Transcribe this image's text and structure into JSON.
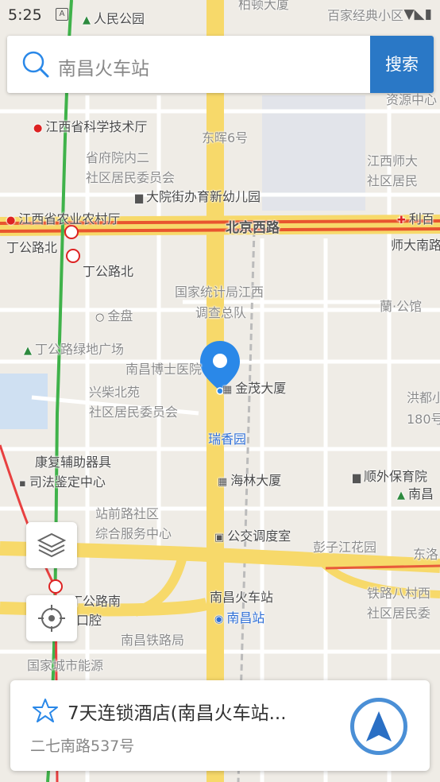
{
  "status_bar": {
    "time": "5:25",
    "sim_label": "A",
    "right_icons": "▼◣▮"
  },
  "search": {
    "query": "南昌火车站",
    "button_label": "搜索"
  },
  "map": {
    "labels": {
      "top_park": "人民公园",
      "top_building": "柏顿大厦",
      "top_right": "百家经典小区",
      "ziyuan": "资源中心",
      "kexue": "江西省科学技术厅",
      "donghui": "东晖6号",
      "shengfu_1": "省府院内二",
      "shengfu_2": "社区居民委员会",
      "jiangxi_shida_1": "江西师大",
      "jiangxi_shida_2": "社区居民",
      "dayuan": "大院街办育新幼儿园",
      "nongye": "江西省农业农村厅",
      "beijing_road": "北京西路",
      "ligong": "利百",
      "dinggong_north_1": "丁公路北",
      "dinggong_north_2": "丁公路北",
      "shida_south": "师大南路",
      "tongji_1": "国家统计局江西",
      "tongji_2": "调查总队",
      "jinpan": "金盘",
      "langong": "蘭·公馆",
      "lvdi": "丁公路绿地广场",
      "boshi": "南昌博士医院",
      "jinmao": "金茂大厦",
      "hongdu_1": "洪都小",
      "hongdu_2": "180号",
      "xingchai_1": "兴柴北苑",
      "xingchai_2": "社区居民委员会",
      "ruixiang": "瑞香园",
      "kangfu": "康复辅助器具",
      "sifa": "司法鉴定中心",
      "hailin": "海林大厦",
      "shunwai": "顺外保育院",
      "nanchang_right": "南昌",
      "zhanqian_1": "站前路社区",
      "zhanqian_2": "综合服务中心",
      "gongjiao": "公交调度室",
      "pengzi": "彭子江花园",
      "dongluo": "东洛",
      "dinggong_south": "丁公路南",
      "huochezhan": "南昌火车站",
      "nanchang_station": "南昌站",
      "tielu_1": "铁路八村西",
      "tielu_2": "社区居民委",
      "kouqiang": "口腔",
      "tieluju": "南昌铁路局",
      "nengyuan": "国家城市能源"
    }
  },
  "card": {
    "title": "7天连锁酒店(南昌火车站...",
    "address": "二七南路537号"
  },
  "colors": {
    "accent": "#2a78c6",
    "nav_ring": "#4a8fd6",
    "pin": "#2a88e8",
    "main_road": "#f7d96a",
    "congested_road": "#e8552f"
  }
}
